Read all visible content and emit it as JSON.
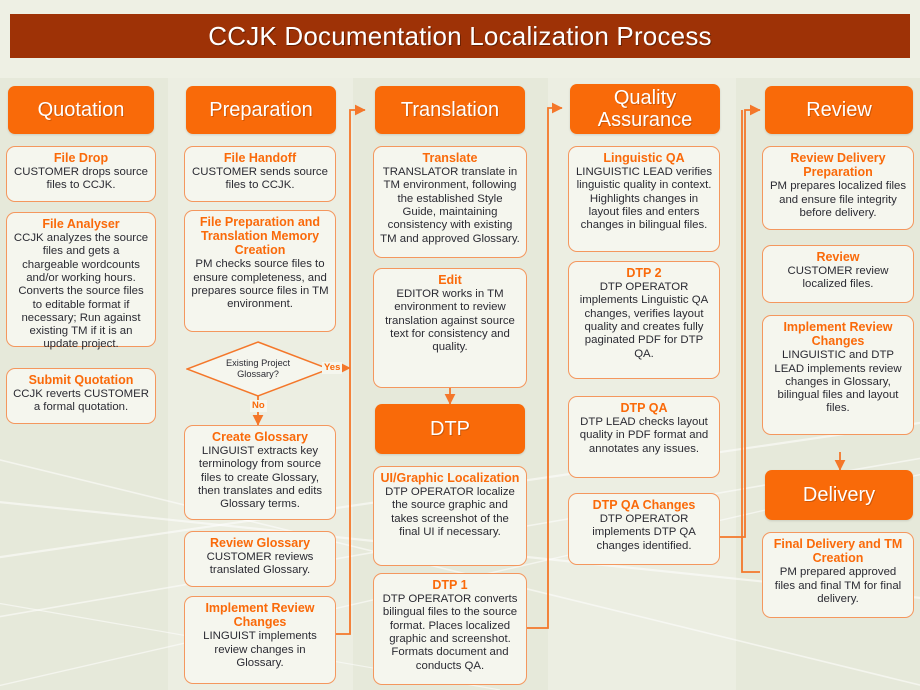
{
  "title": "CCJK Documentation Localization Process",
  "colors": {
    "title_bar": "#9e3206",
    "phase_box": "#f96a09",
    "card_border": "#f4975e",
    "card_heading": "#fa6a0a",
    "card_body_text": "#2b2b33",
    "background": "#eef0e4",
    "connector": "#f4772a"
  },
  "columns": [
    {
      "phase": "Quotation",
      "steps": [
        {
          "heading": "File Drop",
          "body": "CUSTOMER drops source files to CCJK."
        },
        {
          "heading": "File Analyser",
          "body": "CCJK analyzes the source files and gets a chargeable wordcounts and/or working hours. Converts the source files to editable format if necessary; Run against existing TM if it is an update project."
        },
        {
          "heading": "Submit Quotation",
          "body": "CCJK reverts CUSTOMER a formal quotation."
        }
      ]
    },
    {
      "phase": "Preparation",
      "steps": [
        {
          "heading": "File Handoff",
          "body": "CUSTOMER sends source files to CCJK."
        },
        {
          "heading": "File Preparation and Translation Memory Creation",
          "body": "PM checks source files to ensure completeness, and prepares source files in TM environment."
        },
        {
          "heading": "Create Glossary",
          "body": "LINGUIST extracts key terminology from source files to create Glossary, then translates and edits Glossary terms."
        },
        {
          "heading": "Review Glossary",
          "body": "CUSTOMER reviews translated Glossary."
        },
        {
          "heading": "Implement Review Changes",
          "body": "LINGUIST implements review changes in Glossary."
        }
      ],
      "decision": {
        "text_line1": "Existing Project",
        "text_line2": "Glossary?",
        "yes_label": "Yes",
        "no_label": "No"
      }
    },
    {
      "phase": "Translation",
      "steps": [
        {
          "heading": "Translate",
          "body": "TRANSLATOR translate in TM environment, following the established Style Guide, maintaining consistency with existing TM and approved Glossary."
        },
        {
          "heading": "Edit",
          "body": "EDITOR works in TM environment to review translation against source text for consistency and quality."
        }
      ],
      "sub_phase": "DTP",
      "sub_steps": [
        {
          "heading": "UI/Graphic Localization",
          "body": "DTP OPERATOR localize the source graphic and takes screenshot of the final UI if necessary."
        },
        {
          "heading": "DTP 1",
          "body": "DTP OPERATOR converts bilingual files to the source format. Places localized graphic and screenshot. Formats document and conducts QA."
        }
      ]
    },
    {
      "phase": "Quality Assurance",
      "steps": [
        {
          "heading": "Linguistic QA",
          "body": "LINGUISTIC LEAD verifies linguistic quality in context. Highlights changes in layout files and enters changes in bilingual files."
        },
        {
          "heading": "DTP 2",
          "body": "DTP OPERATOR implements Linguistic QA changes, verifies layout quality and creates fully paginated PDF for DTP QA."
        },
        {
          "heading": "DTP QA",
          "body": "DTP LEAD checks layout quality in PDF format and annotates any issues."
        },
        {
          "heading": "DTP QA Changes",
          "body": "DTP OPERATOR implements DTP QA changes identified."
        }
      ]
    },
    {
      "phase": "Review",
      "steps": [
        {
          "heading": "Review Delivery Preparation",
          "body": "PM prepares localized files and ensure file integrity before delivery."
        },
        {
          "heading": "Review",
          "body": "CUSTOMER review localized files."
        },
        {
          "heading": "Implement Review Changes",
          "body": "LINGUISTIC and DTP LEAD implements review changes in Glossary, bilingual files and layout files."
        }
      ],
      "sub_phase": "Delivery",
      "sub_steps": [
        {
          "heading": "Final Delivery and TM Creation",
          "body": "PM prepared approved files and final TM for final delivery."
        }
      ]
    }
  ]
}
